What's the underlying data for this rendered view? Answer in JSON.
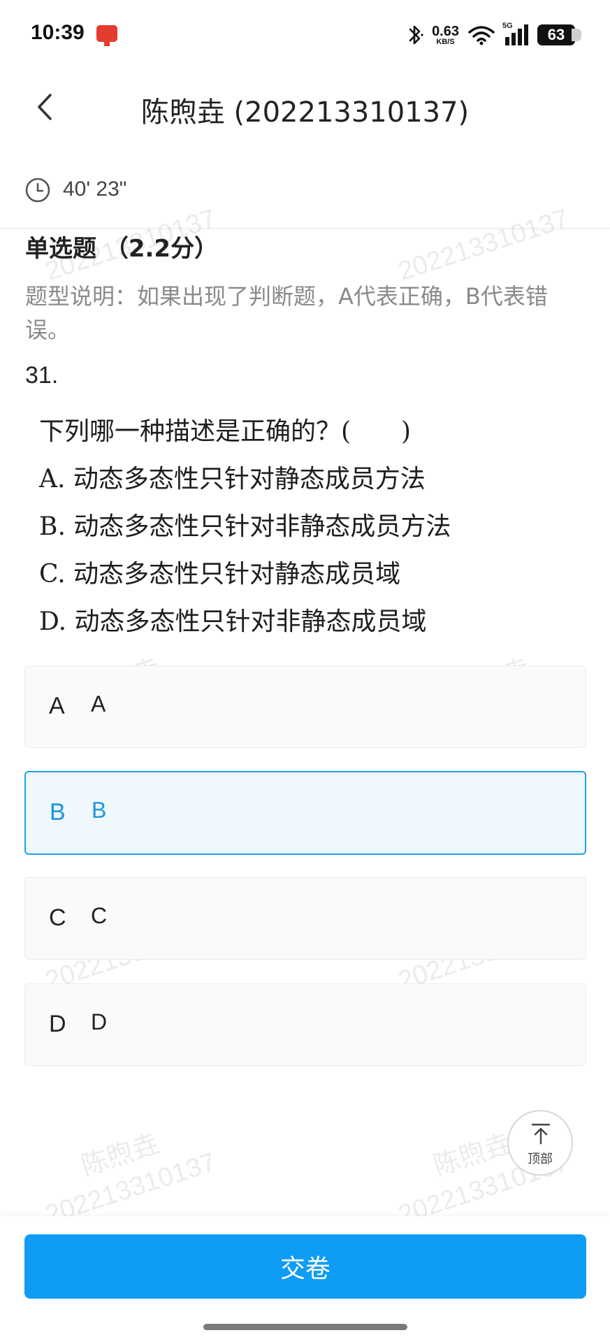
{
  "status_bar": {
    "time": "10:39",
    "net_speed_value": "0.63",
    "net_speed_unit": "KB/S",
    "network_type": "5G",
    "battery": "63",
    "icons": [
      "app-notification-icon",
      "bluetooth-icon",
      "wifi-icon",
      "signal-icon",
      "battery-icon"
    ]
  },
  "header": {
    "title": "陈煦垚 (202213310137)",
    "back_icon": "chevron-left-icon"
  },
  "timer": {
    "value": "40' 23\"",
    "icon": "clock-icon"
  },
  "watermark": {
    "name": "陈煦垚",
    "id": "202213310137"
  },
  "question": {
    "type_label": "单选题 （2.2分）",
    "description": "题型说明：如果出现了判断题，A代表正确，B代表错误。",
    "number": "31.",
    "image_lines": [
      "下列哪一种描述是正确的？(　　)",
      "A. 动态多态性只针对静态成员方法",
      "B. 动态多态性只针对非静态成员方法",
      "C. 动态多态性只针对静态成员域",
      "D. 动态多态性只针对非静态成员域"
    ]
  },
  "options": [
    {
      "letter": "A",
      "text": "A",
      "selected": false
    },
    {
      "letter": "B",
      "text": "B",
      "selected": true
    },
    {
      "letter": "C",
      "text": "C",
      "selected": false
    },
    {
      "letter": "D",
      "text": "D",
      "selected": false
    }
  ],
  "back_to_top": {
    "label": "顶部",
    "icon": "arrow-up-to-top-icon"
  },
  "submit": {
    "label": "交卷"
  },
  "colors": {
    "accent": "#0f9cf5",
    "selected_text": "#1a96de",
    "selected_bg": "#eef8fd",
    "status_notification": "#e43d30"
  }
}
